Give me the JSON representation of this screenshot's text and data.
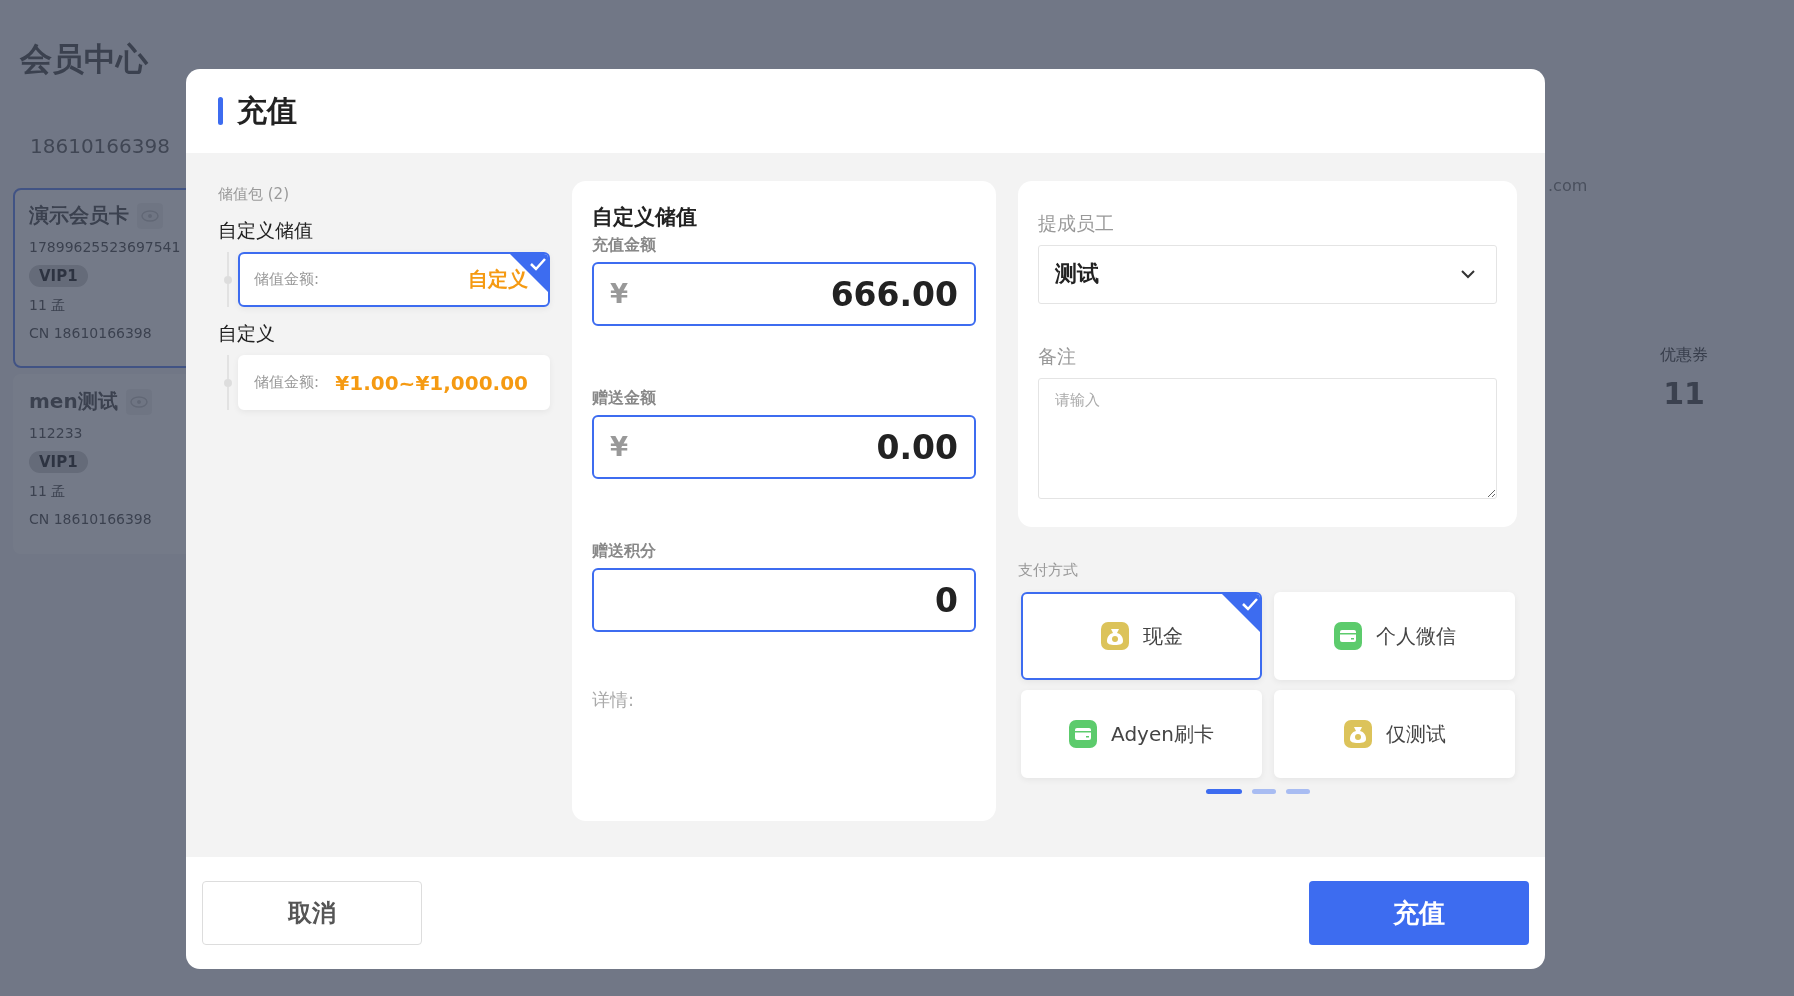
{
  "background": {
    "page_title": "会员中心",
    "phone": "18610166398",
    "member_cards": [
      {
        "name": "演示会员卡",
        "number": "17899625523697541",
        "level": "VIP1",
        "holder": "11 孟",
        "contact": "CN 18610166398",
        "selected": true
      },
      {
        "name": "men测试",
        "number": "112233",
        "level": "VIP1",
        "holder": "11 孟",
        "contact": "CN 18610166398",
        "selected": false
      }
    ],
    "email_fragment": ".com",
    "coupon": {
      "label": "优惠券",
      "value": "11"
    }
  },
  "dialog": {
    "title": "充值",
    "packages": {
      "label": "储值包 (2)",
      "groups": [
        {
          "title": "自定义储值",
          "item": {
            "label": "储值金额:",
            "value": "自定义",
            "selected": true
          }
        },
        {
          "title": "自定义",
          "item": {
            "label": "储值金额:",
            "value": "¥1.00~¥1,000.00",
            "selected": false
          }
        }
      ]
    },
    "custom": {
      "heading": "自定义储值",
      "fields": [
        {
          "label": "充值金额",
          "currency": "¥",
          "value": "666.00"
        },
        {
          "label": "赠送金额",
          "currency": "¥",
          "value": "0.00"
        },
        {
          "label": "赠送积分",
          "value": "0"
        }
      ],
      "details_label": "详情:"
    },
    "staff": {
      "label": "提成员工",
      "value": "测试"
    },
    "remark": {
      "label": "备注",
      "placeholder": "请输入"
    },
    "payment": {
      "label": "支付方式",
      "methods": [
        {
          "name": "现金",
          "kind": "moneybag",
          "selected": true
        },
        {
          "name": "个人微信",
          "kind": "card",
          "selected": false
        },
        {
          "name": "Adyen刷卡",
          "kind": "card",
          "selected": false
        },
        {
          "name": "仅测试",
          "kind": "moneybag",
          "selected": false
        }
      ],
      "pages": [
        {
          "selected": true
        },
        {
          "selected": false
        },
        {
          "selected": false
        }
      ]
    },
    "buttons": {
      "cancel": "取消",
      "submit": "充值"
    }
  }
}
